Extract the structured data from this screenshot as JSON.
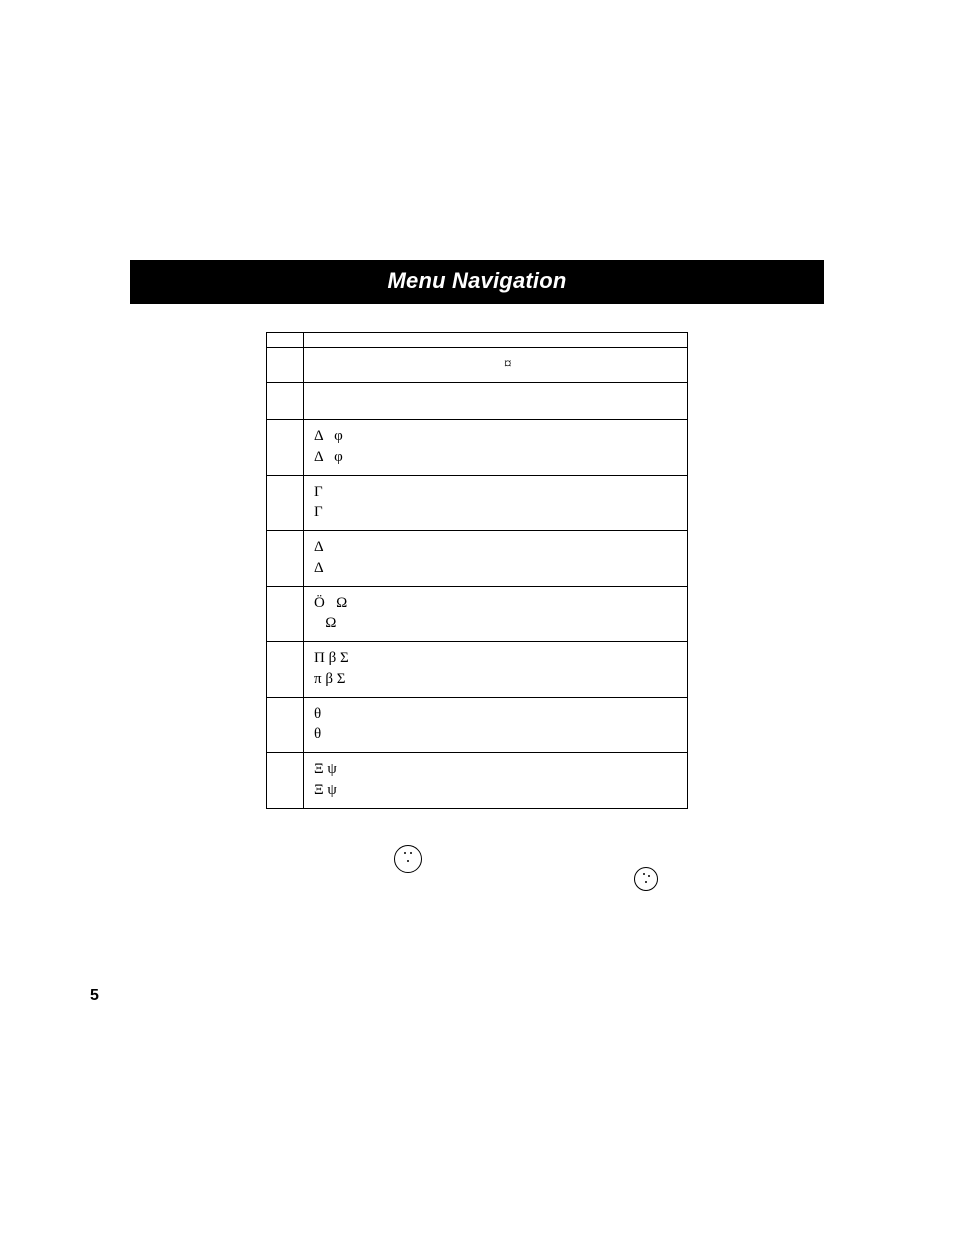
{
  "title": "Menu Navigation",
  "page_number": "5",
  "table": {
    "rows": [
      {
        "lines": [
          ""
        ],
        "tall": false,
        "class": ""
      },
      {
        "lines": [
          "¤"
        ],
        "tall": false,
        "class": "currency-row"
      },
      {
        "lines": [
          ""
        ],
        "tall": true,
        "class": "pad-tall"
      },
      {
        "lines": [
          "Δ   φ",
          "Δ   φ"
        ],
        "tall": false,
        "class": ""
      },
      {
        "lines": [
          "Γ",
          "Γ"
        ],
        "tall": false,
        "class": ""
      },
      {
        "lines": [
          "Δ",
          "Δ"
        ],
        "tall": false,
        "class": ""
      },
      {
        "lines": [
          "Ö   Ω",
          "   Ω"
        ],
        "tall": false,
        "class": ""
      },
      {
        "lines": [
          "Π β Σ",
          "π β Σ"
        ],
        "tall": false,
        "class": ""
      },
      {
        "lines": [
          "θ",
          "θ"
        ],
        "tall": false,
        "class": ""
      },
      {
        "lines": [
          "Ξ ψ",
          "Ξ ψ"
        ],
        "tall": false,
        "class": ""
      }
    ]
  }
}
